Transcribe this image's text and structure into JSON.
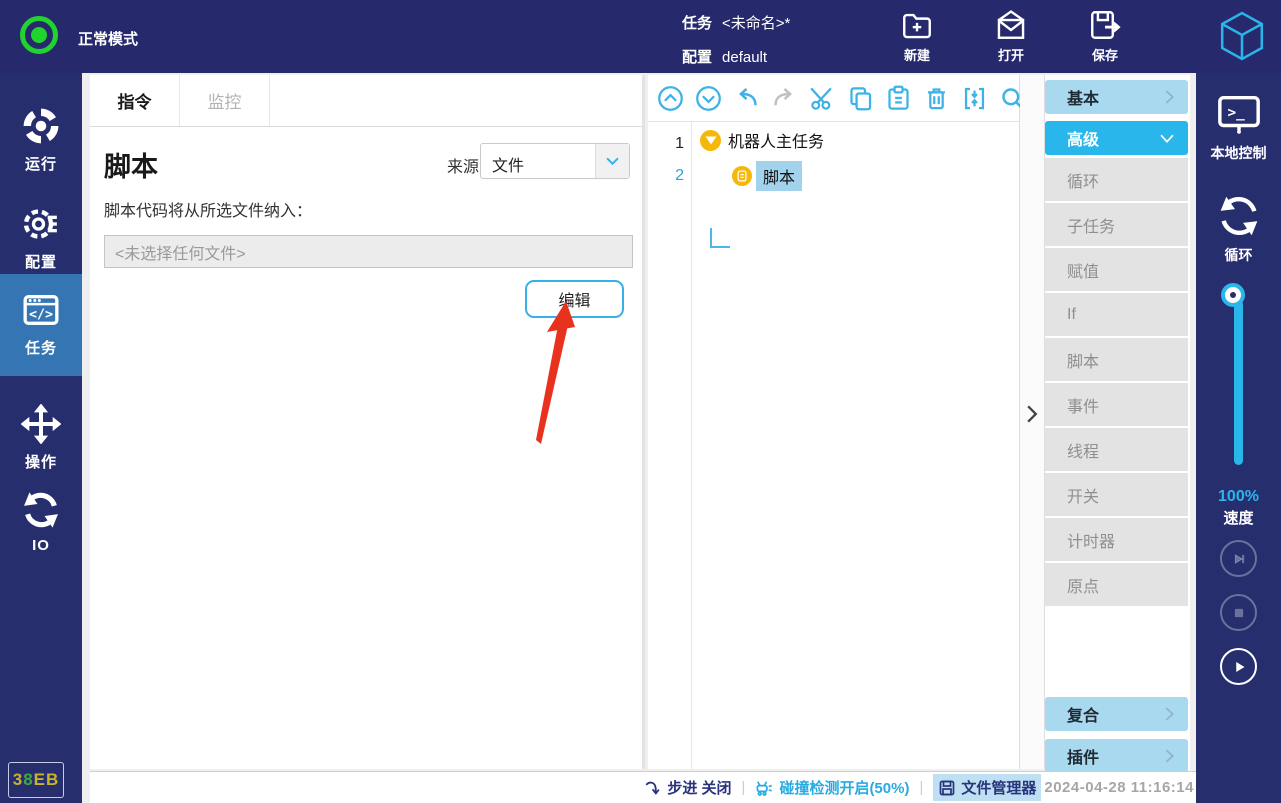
{
  "colors": {
    "accent_cyan": "#29abe2",
    "advanced_header_bg": "#29b6ea",
    "light_header_bg": "#a9d9ef",
    "tree_selection_bg": "#a3d2ed",
    "node_yellow": "#f5b70a",
    "navy_bar": "#262a6d",
    "nav_active_bg": "#3575b4",
    "arrow_red": "#e8321e",
    "status_green": "#21d32f"
  },
  "topbar": {
    "mode_label": "正常模式",
    "task_label": "任务",
    "task_value": "<未命名>*",
    "config_label": "配置",
    "config_value": "default",
    "actions": [
      {
        "label": "新建",
        "icon": "new-task-icon"
      },
      {
        "label": "打开",
        "icon": "open-icon"
      },
      {
        "label": "保存",
        "icon": "save-icon"
      }
    ]
  },
  "left_nav": {
    "items": [
      {
        "label": "运行",
        "icon": "run-icon",
        "active": false
      },
      {
        "label": "配置",
        "icon": "gear-icon",
        "active": false
      },
      {
        "label": "任务",
        "icon": "task-code-icon",
        "active": true
      },
      {
        "label": "操作",
        "icon": "move-arrows-icon",
        "active": false
      },
      {
        "label": "IO",
        "icon": "io-swap-icon",
        "active": false
      }
    ]
  },
  "main": {
    "tabs": [
      {
        "label": "指令",
        "active": true
      },
      {
        "label": "监控",
        "active": false
      }
    ],
    "title": "脚本",
    "source_label": "来源",
    "source_value": "文件",
    "description": "脚本代码将从所选文件纳入：",
    "file_value": "<未选择任何文件>",
    "edit_button": "编辑"
  },
  "tree": {
    "toolbar_icons": [
      "move-up-icon",
      "move-down-icon",
      "undo-icon",
      "redo-icon",
      "cut-icon",
      "copy-icon",
      "paste-icon",
      "delete-icon",
      "insert-icon",
      "search-icon"
    ],
    "rows": [
      {
        "num": "1",
        "label": "机器人主任务",
        "selected": false
      },
      {
        "num": "2",
        "label": "脚本",
        "selected": true
      }
    ]
  },
  "instruction_panel": {
    "basic_header": "基本",
    "advanced_header": "高级",
    "advanced_items": [
      "循环",
      "子任务",
      "赋值",
      "If",
      "脚本",
      "事件",
      "线程",
      "开关",
      "计时器",
      "原点"
    ],
    "composite_header": "复合",
    "plugin_header": "插件"
  },
  "right_bar": {
    "local_control_label": "本地控制",
    "loop_label": "循环",
    "speed_value": "100%",
    "speed_label": "速度",
    "playback_icons": [
      "step-next-icon",
      "stop-icon",
      "play-icon"
    ]
  },
  "status_bar": {
    "device_code_part1": "3",
    "device_code_part2": "8",
    "device_code_part3": "EB",
    "step_label": "步进 关闭",
    "collision_label": "碰撞检测开启(50%)",
    "file_manager_label": "文件管理器",
    "timestamp": "2024-04-28 11:16:14",
    "separator": "|"
  }
}
